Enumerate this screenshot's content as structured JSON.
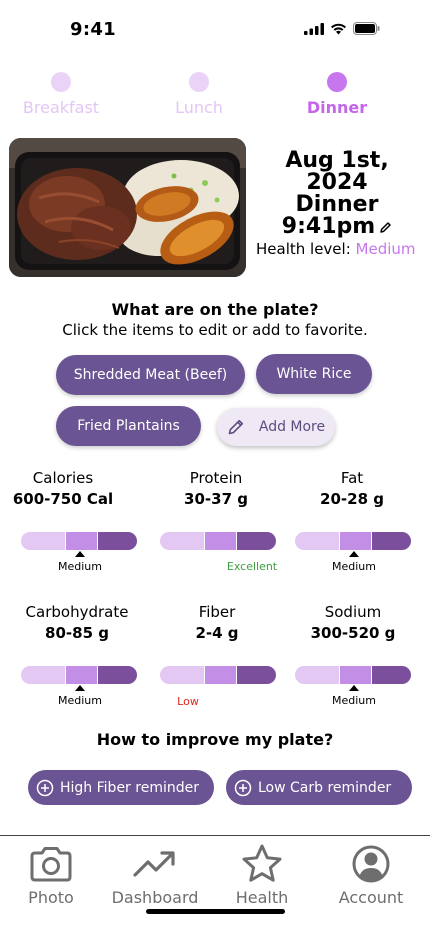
{
  "status_bar": {
    "time": "9:41"
  },
  "meal_tabs": [
    {
      "label": "Breakfast",
      "active": false
    },
    {
      "label": "Lunch",
      "active": false
    },
    {
      "label": "Dinner",
      "active": true
    }
  ],
  "entry": {
    "date": "Aug 1st, 2024",
    "meal": "Dinner",
    "time": "9:41pm",
    "health_label": "Health level:",
    "health_value": "Medium"
  },
  "plate": {
    "heading": "What are on the plate?",
    "subheading": "Click the items to edit or add to favorite.",
    "items": [
      "Shredded Meat (Beef)",
      "White Rice",
      "Fried Plantains"
    ],
    "add_label": "Add More"
  },
  "metrics": [
    {
      "name": "Calories",
      "value": "600-750 Cal",
      "rating": "Medium",
      "level": 0.5
    },
    {
      "name": "Protein",
      "value": "30-37 g",
      "rating": "Excellent",
      "level": null
    },
    {
      "name": "Fat",
      "value": "20-28 g",
      "rating": "Medium",
      "level": 0.5
    },
    {
      "name": "Carbohydrate",
      "value": "80-85 g",
      "rating": "Medium",
      "level": 0.5
    },
    {
      "name": "Fiber",
      "value": "2-4 g",
      "rating": "Low",
      "level": null
    },
    {
      "name": "Sodium",
      "value": "300-520 g",
      "rating": "Medium",
      "level": 0.5
    }
  ],
  "improve": {
    "heading": "How to improve my plate?",
    "reminders": [
      "High Fiber reminder",
      "Low Carb reminder"
    ]
  },
  "tab_bar": {
    "items": [
      {
        "label": "Photo",
        "icon": "camera-icon"
      },
      {
        "label": "Dashboard",
        "icon": "trending-up-icon"
      },
      {
        "label": "Health",
        "icon": "star-icon"
      },
      {
        "label": "Account",
        "icon": "user-circle-icon"
      }
    ]
  },
  "colors": {
    "accent": "#c876ee",
    "chip": "#6a5493",
    "excellent": "#3e9e3e",
    "low": "#e0261e"
  }
}
